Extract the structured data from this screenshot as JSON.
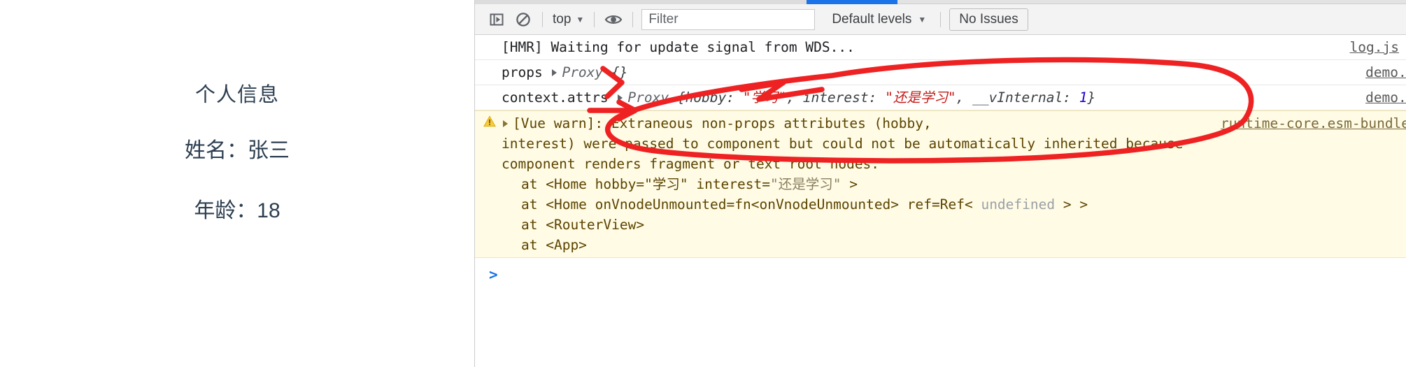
{
  "app": {
    "title": "个人信息",
    "name_line": "姓名：张三",
    "age_line": "年龄：18"
  },
  "devtools": {
    "toolbar": {
      "sidebar_toggle_icon": "show-console-sidebar-icon",
      "clear_console_icon": "clear-console-icon",
      "context_label": "top",
      "eye_icon": "live-expression-eye-icon",
      "filter_placeholder": "Filter",
      "filter_value": "",
      "levels_label": "Default levels",
      "issues_label": "No Issues",
      "caret_glyph": "▼"
    },
    "accent_color": "#1a73e8",
    "warning_bg": "#fffbe5",
    "string_color": "#c41a16",
    "number_color": "#1c00cf",
    "rows": [
      {
        "id": "hmr-row",
        "text": "[HMR] Waiting for update signal from WDS...",
        "source": "log.js"
      },
      {
        "id": "props-row",
        "label": "props",
        "proxy_word": "Proxy",
        "body": "{}",
        "source": "demo.vue"
      },
      {
        "id": "context-attrs-row",
        "label": "context.attrs",
        "proxy_word": "Proxy",
        "brace_open": "{hobby: ",
        "hobby_value": "\"学习\"",
        "sep1": ", interest: ",
        "interest_value": "\"还是学习\"",
        "sep2": ", __vInternal: ",
        "internal_value": "1",
        "brace_close": "}",
        "source": "demo.vue"
      }
    ],
    "warning": {
      "source": "runtime-core.esm-bundler.js",
      "line1": "[Vue warn]: Extraneous non-props attributes (hobby,",
      "line2": "interest) were passed to component but could not be automatically inherited because",
      "line3": "component renders fragment or text root nodes.",
      "stack": [
        "at <Home hobby=\"学习\" interest=\"还是学习\" >",
        "at <Home onVnodeUnmounted=fn<onVnodeUnmounted> ref=Ref< undefined > >",
        "at <RouterView>",
        "at <App>"
      ],
      "stack_home_prefix": "at <Home hobby=",
      "stack_home_hobby": "\"学习\"",
      "stack_home_mid": " interest=",
      "stack_home_interest": "\"还是学习\"",
      "stack_home_suffix": " >",
      "stack_home2_a": "at <Home onVnodeUnmounted=fn<onVnodeUnmounted> ref=Ref< ",
      "stack_home2_undef": "undefined",
      "stack_home2_b": " > >"
    },
    "prompt_glyph": ">"
  },
  "annotation": {
    "color": "#ee2222",
    "shapes": "hand-drawn red arrows and ellipse highlighting context.attrs Proxy output"
  }
}
